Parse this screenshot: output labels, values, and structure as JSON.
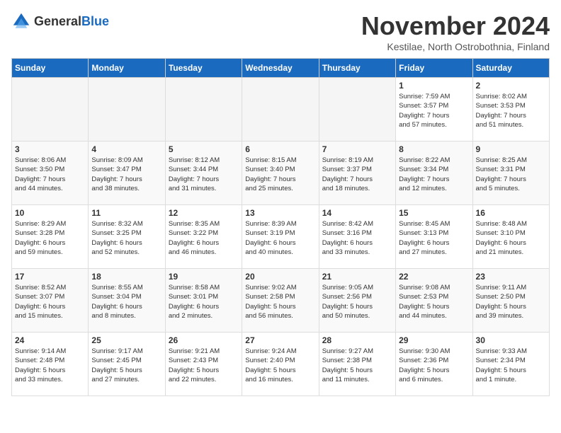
{
  "logo": {
    "general": "General",
    "blue": "Blue"
  },
  "title": "November 2024",
  "location": "Kestilae, North Ostrobothnia, Finland",
  "weekdays": [
    "Sunday",
    "Monday",
    "Tuesday",
    "Wednesday",
    "Thursday",
    "Friday",
    "Saturday"
  ],
  "weeks": [
    [
      {
        "day": "",
        "info": ""
      },
      {
        "day": "",
        "info": ""
      },
      {
        "day": "",
        "info": ""
      },
      {
        "day": "",
        "info": ""
      },
      {
        "day": "",
        "info": ""
      },
      {
        "day": "1",
        "info": "Sunrise: 7:59 AM\nSunset: 3:57 PM\nDaylight: 7 hours\nand 57 minutes."
      },
      {
        "day": "2",
        "info": "Sunrise: 8:02 AM\nSunset: 3:53 PM\nDaylight: 7 hours\nand 51 minutes."
      }
    ],
    [
      {
        "day": "3",
        "info": "Sunrise: 8:06 AM\nSunset: 3:50 PM\nDaylight: 7 hours\nand 44 minutes."
      },
      {
        "day": "4",
        "info": "Sunrise: 8:09 AM\nSunset: 3:47 PM\nDaylight: 7 hours\nand 38 minutes."
      },
      {
        "day": "5",
        "info": "Sunrise: 8:12 AM\nSunset: 3:44 PM\nDaylight: 7 hours\nand 31 minutes."
      },
      {
        "day": "6",
        "info": "Sunrise: 8:15 AM\nSunset: 3:40 PM\nDaylight: 7 hours\nand 25 minutes."
      },
      {
        "day": "7",
        "info": "Sunrise: 8:19 AM\nSunset: 3:37 PM\nDaylight: 7 hours\nand 18 minutes."
      },
      {
        "day": "8",
        "info": "Sunrise: 8:22 AM\nSunset: 3:34 PM\nDaylight: 7 hours\nand 12 minutes."
      },
      {
        "day": "9",
        "info": "Sunrise: 8:25 AM\nSunset: 3:31 PM\nDaylight: 7 hours\nand 5 minutes."
      }
    ],
    [
      {
        "day": "10",
        "info": "Sunrise: 8:29 AM\nSunset: 3:28 PM\nDaylight: 6 hours\nand 59 minutes."
      },
      {
        "day": "11",
        "info": "Sunrise: 8:32 AM\nSunset: 3:25 PM\nDaylight: 6 hours\nand 52 minutes."
      },
      {
        "day": "12",
        "info": "Sunrise: 8:35 AM\nSunset: 3:22 PM\nDaylight: 6 hours\nand 46 minutes."
      },
      {
        "day": "13",
        "info": "Sunrise: 8:39 AM\nSunset: 3:19 PM\nDaylight: 6 hours\nand 40 minutes."
      },
      {
        "day": "14",
        "info": "Sunrise: 8:42 AM\nSunset: 3:16 PM\nDaylight: 6 hours\nand 33 minutes."
      },
      {
        "day": "15",
        "info": "Sunrise: 8:45 AM\nSunset: 3:13 PM\nDaylight: 6 hours\nand 27 minutes."
      },
      {
        "day": "16",
        "info": "Sunrise: 8:48 AM\nSunset: 3:10 PM\nDaylight: 6 hours\nand 21 minutes."
      }
    ],
    [
      {
        "day": "17",
        "info": "Sunrise: 8:52 AM\nSunset: 3:07 PM\nDaylight: 6 hours\nand 15 minutes."
      },
      {
        "day": "18",
        "info": "Sunrise: 8:55 AM\nSunset: 3:04 PM\nDaylight: 6 hours\nand 8 minutes."
      },
      {
        "day": "19",
        "info": "Sunrise: 8:58 AM\nSunset: 3:01 PM\nDaylight: 6 hours\nand 2 minutes."
      },
      {
        "day": "20",
        "info": "Sunrise: 9:02 AM\nSunset: 2:58 PM\nDaylight: 5 hours\nand 56 minutes."
      },
      {
        "day": "21",
        "info": "Sunrise: 9:05 AM\nSunset: 2:56 PM\nDaylight: 5 hours\nand 50 minutes."
      },
      {
        "day": "22",
        "info": "Sunrise: 9:08 AM\nSunset: 2:53 PM\nDaylight: 5 hours\nand 44 minutes."
      },
      {
        "day": "23",
        "info": "Sunrise: 9:11 AM\nSunset: 2:50 PM\nDaylight: 5 hours\nand 39 minutes."
      }
    ],
    [
      {
        "day": "24",
        "info": "Sunrise: 9:14 AM\nSunset: 2:48 PM\nDaylight: 5 hours\nand 33 minutes."
      },
      {
        "day": "25",
        "info": "Sunrise: 9:17 AM\nSunset: 2:45 PM\nDaylight: 5 hours\nand 27 minutes."
      },
      {
        "day": "26",
        "info": "Sunrise: 9:21 AM\nSunset: 2:43 PM\nDaylight: 5 hours\nand 22 minutes."
      },
      {
        "day": "27",
        "info": "Sunrise: 9:24 AM\nSunset: 2:40 PM\nDaylight: 5 hours\nand 16 minutes."
      },
      {
        "day": "28",
        "info": "Sunrise: 9:27 AM\nSunset: 2:38 PM\nDaylight: 5 hours\nand 11 minutes."
      },
      {
        "day": "29",
        "info": "Sunrise: 9:30 AM\nSunset: 2:36 PM\nDaylight: 5 hours\nand 6 minutes."
      },
      {
        "day": "30",
        "info": "Sunrise: 9:33 AM\nSunset: 2:34 PM\nDaylight: 5 hours\nand 1 minute."
      }
    ]
  ]
}
